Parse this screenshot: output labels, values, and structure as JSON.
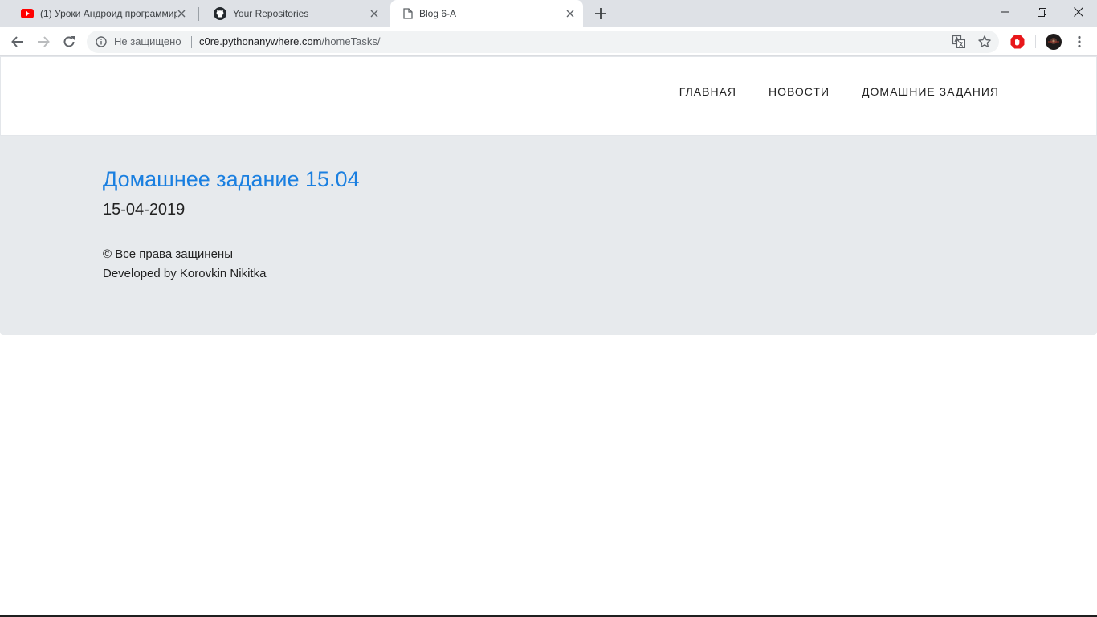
{
  "browser": {
    "tabs": [
      {
        "title": "(1) Уроки Андроид программир",
        "favicon": "youtube-icon",
        "active": false
      },
      {
        "title": "Your Repositories",
        "favicon": "github-icon",
        "active": false
      },
      {
        "title": "Blog 6-A",
        "favicon": "page-icon",
        "active": true
      }
    ],
    "omnibox": {
      "security_label": "Не защищено",
      "url_host": "c0re.pythonanywhere.com",
      "url_path": "/homeTasks/"
    },
    "colors": {
      "tabstrip": "#dee1e6",
      "youtube_red": "#ff0000",
      "extension_red": "#e8171b"
    }
  },
  "site": {
    "nav": {
      "home": "ГЛАВНАЯ",
      "news": "НОВОСТИ",
      "homework": "ДОМАШНИЕ ЗАДАНИЯ"
    },
    "post": {
      "title": "Домашнее задание 15.04",
      "date": "15-04-2019"
    },
    "footer": {
      "copyright": "© Все права защинены",
      "developer": "Developed by Korovkin Nikitka"
    },
    "colors": {
      "link_blue": "#1a7fe0",
      "content_bg": "#e7eaed"
    }
  }
}
